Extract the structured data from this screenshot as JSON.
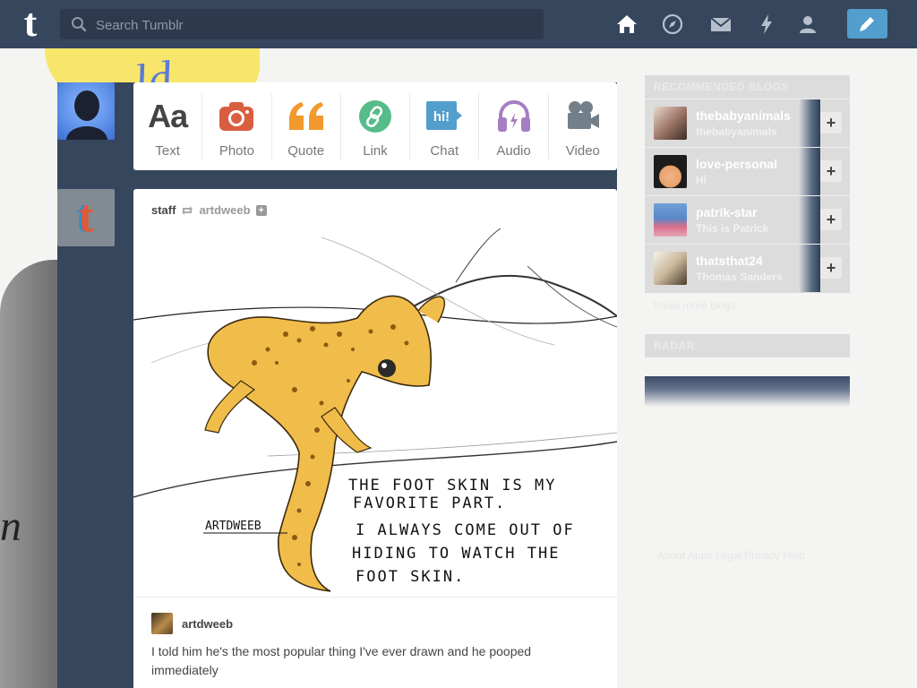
{
  "topbar": {
    "logo": "t",
    "search_placeholder": "Search Tumblr",
    "nav_icons": [
      "home-icon",
      "explore-icon",
      "inbox-icon",
      "activity-icon",
      "account-icon"
    ],
    "compose_icon": "pencil-icon"
  },
  "background": {
    "script_text": "ld",
    "hood_text": "n"
  },
  "post_types": [
    {
      "label": "Text",
      "icon": "text-icon",
      "color": "#444444"
    },
    {
      "label": "Photo",
      "icon": "camera-icon",
      "color": "#d95e40"
    },
    {
      "label": "Quote",
      "icon": "quote-icon",
      "color": "#f2992e"
    },
    {
      "label": "Link",
      "icon": "link-icon",
      "color": "#56bc8a"
    },
    {
      "label": "Chat",
      "icon": "chat-icon",
      "color": "#529ecc"
    },
    {
      "label": "Audio",
      "icon": "headphones-icon",
      "color": "#a77dc2"
    },
    {
      "label": "Video",
      "icon": "video-camera-icon",
      "color": "#748089"
    }
  ],
  "post": {
    "author": "staff",
    "reblogged_from": "artdweeb",
    "follow_label": "+",
    "art": {
      "signature": "ARTDWEEB",
      "line1": "THE FOOT SKIN IS MY",
      "line2": "FAVORITE PART.",
      "line3": "I ALWAYS COME OUT OF",
      "line4": "HIDING TO WATCH THE",
      "line5": "FOOT SKIN."
    },
    "reblogger": "artdweeb",
    "caption": "I told him he's the most popular thing I've ever drawn and he pooped immediately"
  },
  "sidebar": {
    "recommended_title": "RECOMMENDED BLOGS",
    "blogs": [
      {
        "name": "thebabyanimals",
        "sub": "thebabyanimals",
        "avatar_color": "#b08a78",
        "follow": "+"
      },
      {
        "name": "love-personal",
        "sub": "Hi",
        "avatar_color": "#e8a06a",
        "follow": "+"
      },
      {
        "name": "patrik-star",
        "sub": "This is Patrick",
        "avatar_color": "#5a88c8",
        "follow": "+"
      },
      {
        "name": "thatsthat24",
        "sub": "Thomas Sanders",
        "avatar_color": "#c9b79a",
        "follow": "+"
      }
    ],
    "show_more": "Show more blogs",
    "radar_title": "RADAR",
    "footer_faint": "About  Apps  Legal  Privacy  Help"
  },
  "colors": {
    "navy": "#36465d",
    "compose": "#529ecc"
  }
}
